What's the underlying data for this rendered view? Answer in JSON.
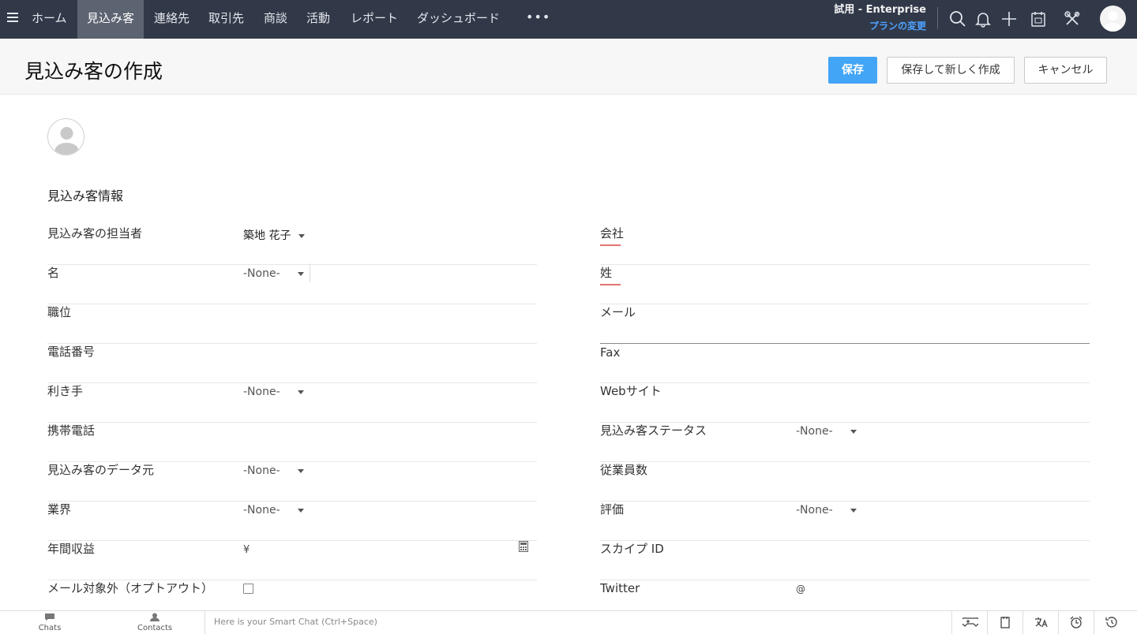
{
  "nav": {
    "items": [
      "ホーム",
      "見込み客",
      "連絡先",
      "取引先",
      "商談",
      "活動",
      "レポート",
      "ダッシュボード"
    ],
    "more": "•••",
    "trial_title": "試用 - Enterprise",
    "trial_link": "プランの変更"
  },
  "header": {
    "title": "見込み客の作成",
    "save": "保存",
    "save_new": "保存して新しく作成",
    "cancel": "キャンセル"
  },
  "section": {
    "title": "見込み客情報"
  },
  "form": {
    "left": [
      {
        "label": "見込み客の担当者",
        "value": "築地 花子"
      },
      {
        "label": "名",
        "value": "-None-"
      },
      {
        "label": "職位"
      },
      {
        "label": "電話番号"
      },
      {
        "label": "利き手",
        "value": "-None-"
      },
      {
        "label": "携帯電話"
      },
      {
        "label": "見込み客のデータ元",
        "value": "-None-"
      },
      {
        "label": "業界",
        "value": "-None-"
      },
      {
        "label": "年間収益",
        "prefix": "¥"
      },
      {
        "label": "メール対象外（オプトアウト）"
      }
    ],
    "right": [
      {
        "label": "会社"
      },
      {
        "label": "姓"
      },
      {
        "label": "メール"
      },
      {
        "label": "Fax"
      },
      {
        "label": "Webサイト"
      },
      {
        "label": "見込み客ステータス",
        "value": "-None-"
      },
      {
        "label": "従業員数"
      },
      {
        "label": "評価",
        "value": "-None-"
      },
      {
        "label": "スカイプ ID"
      },
      {
        "label": "Twitter",
        "prefix": "@"
      }
    ]
  },
  "bottom": {
    "chats": "Chats",
    "contacts": "Contacts",
    "smart_chat_placeholder": "Here is your Smart Chat (Ctrl+Space)"
  },
  "colors": {
    "nav_bg": "#313949",
    "primary": "#42a5f5",
    "required": "#e57373",
    "link": "#4ea2ff"
  }
}
